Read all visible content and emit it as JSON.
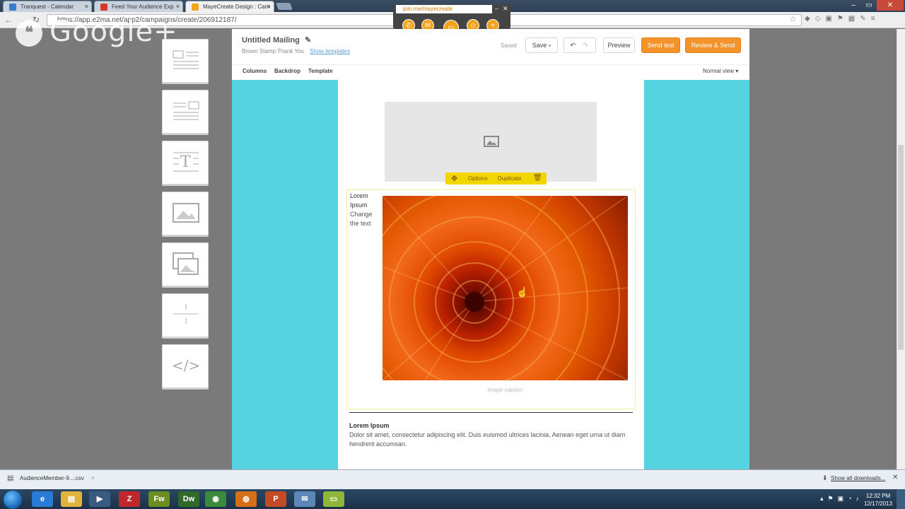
{
  "browser": {
    "tabs": [
      {
        "label": "Tranquest - Calendar",
        "color": "#3b7bd1"
      },
      {
        "label": "Feed Your Audience Exp",
        "color": "#d8382a"
      },
      {
        "label": "MayeCreate Design : Cam",
        "color": "#f1a51c"
      }
    ],
    "url": "https://app.e2ma.net/app2/campaigns/create/206912187/",
    "overlay_text": "Google+"
  },
  "hangout": {
    "url": "join.me/mayecreate",
    "buttons": [
      "phone-icon",
      "chat-icon",
      "screen-icon",
      "people-icon",
      "add-icon"
    ]
  },
  "palette": [
    "text-block",
    "text-image-block",
    "text-columns-block",
    "image-block",
    "image-group-block",
    "divider-block",
    "code-block"
  ],
  "editor": {
    "title": "Untitled Mailing",
    "subtitle": "Brown Stamp Thank You",
    "show_templates": "Show templates",
    "saved": "Saved",
    "save": "Save",
    "preview": "Preview",
    "send_test": "Send test",
    "review_send": "Review & Send",
    "subnav": [
      "Columns",
      "Backdrop",
      "Template"
    ],
    "view": "Normal view"
  },
  "block_toolbar": {
    "options": "Options",
    "duplicate": "Duplicate"
  },
  "content": {
    "lorem_title": "Lorem Ipsum",
    "change_text": "Change the text",
    "caption": "image caption",
    "lorem2_title": "Lorem Ipsum",
    "lorem2_body": "Dolor sit amet, consectetur adipiscing elit. Duis euismod ultrices lacinia. Aenean eget urna ut diam hendrerit accumsan."
  },
  "downloads": {
    "file": "AudienceMember-9....csv",
    "show_all": "Show all downloads..."
  },
  "taskbar": {
    "apps": [
      {
        "name": "ie",
        "label": "e",
        "color": "#2a7bd8"
      },
      {
        "name": "explorer",
        "label": "▤",
        "color": "#e2b33a"
      },
      {
        "name": "media",
        "label": "▶",
        "color": "#3a5a80"
      },
      {
        "name": "filezilla",
        "label": "Z",
        "color": "#c0272d"
      },
      {
        "name": "fireworks",
        "label": "Fw",
        "color": "#6a8f1f"
      },
      {
        "name": "dreamweaver",
        "label": "Dw",
        "color": "#2e6b2b"
      },
      {
        "name": "chrome",
        "label": "◉",
        "color": "#3c8a3c"
      },
      {
        "name": "firefox",
        "label": "◍",
        "color": "#d76f1a"
      },
      {
        "name": "powerpoint",
        "label": "P",
        "color": "#c44a25"
      },
      {
        "name": "outlook",
        "label": "✉",
        "color": "#5b88b8"
      },
      {
        "name": "chat",
        "label": "▭",
        "color": "#8fb83a"
      }
    ],
    "time": "12:32 PM",
    "date": "12/17/2013"
  }
}
